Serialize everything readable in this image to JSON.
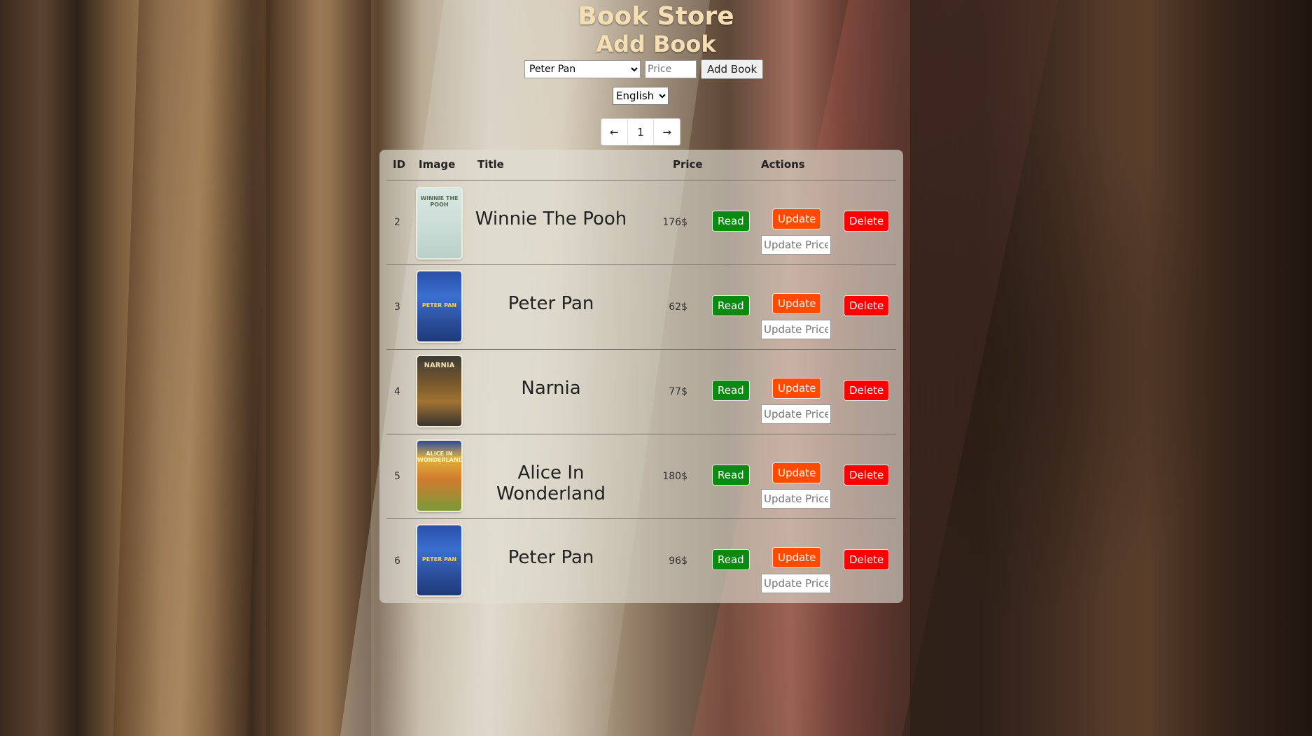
{
  "header": {
    "title": "Book Store",
    "subtitle": "Add Book"
  },
  "add_form": {
    "book_selected": "Peter Pan",
    "price_placeholder": "Price",
    "add_button": "Add Book"
  },
  "language": {
    "selected": "English"
  },
  "pagination": {
    "prev": "←",
    "page": "1",
    "next": "→"
  },
  "table": {
    "columns": [
      "ID",
      "Image",
      "Title",
      "Price",
      "Actions"
    ],
    "rows": [
      {
        "id": "2",
        "title": "Winnie The Pooh",
        "price": "176$",
        "cover": "WINNIE THE POOH"
      },
      {
        "id": "3",
        "title": "Peter Pan",
        "price": "62$",
        "cover": "PETER PAN"
      },
      {
        "id": "4",
        "title": "Narnia",
        "price": "77$",
        "cover": "NARNIA"
      },
      {
        "id": "5",
        "title": "Alice In Wonderland",
        "price": "180$",
        "cover": "ALICE IN WONDERLAND"
      },
      {
        "id": "6",
        "title": "Peter Pan",
        "price": "96$",
        "cover": "PETER PAN"
      }
    ],
    "actions": {
      "read": "Read",
      "update": "Update",
      "delete": "Delete",
      "update_placeholder": "Update Price"
    }
  },
  "colors": {
    "title": "#f5deb3",
    "read": "#0b8a12",
    "update": "#ff4a00",
    "delete": "#ff0000"
  }
}
